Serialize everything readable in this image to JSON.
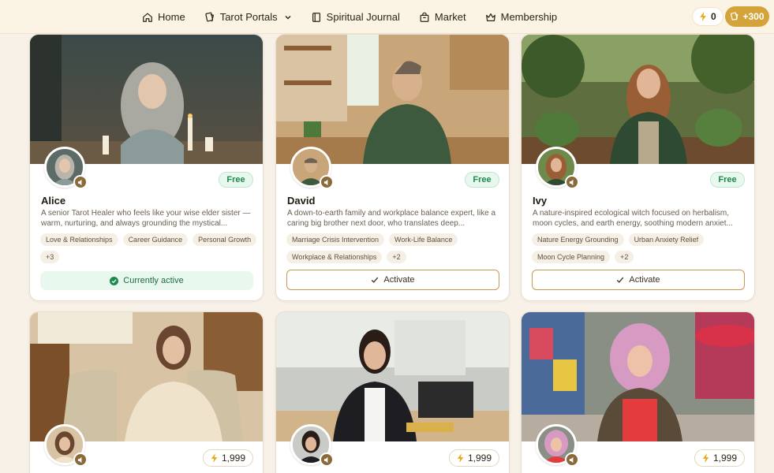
{
  "nav": {
    "items": [
      {
        "label": "Home",
        "icon": "home-icon"
      },
      {
        "label": "Tarot Portals",
        "icon": "tarot-card-icon",
        "dropdown": true
      },
      {
        "label": "Spiritual Journal",
        "icon": "journal-icon"
      },
      {
        "label": "Market",
        "icon": "shopping-bag-icon"
      },
      {
        "label": "Membership",
        "icon": "crown-icon"
      }
    ],
    "energy": "0",
    "coins": "+300"
  },
  "colors": {
    "accent": "#d4a33a",
    "free": "#1d8a4c",
    "active_bg": "#e9f8ef",
    "button_border": "#c79a52"
  },
  "cards": [
    {
      "name": "Alice",
      "badge": "Free",
      "desc": "A senior Tarot Healer who feels like your wise elder sister — warm, nurturing, and always grounding the mystical...",
      "tags": [
        "Love & Relationships",
        "Career Guidance",
        "Personal Growth",
        "+3"
      ],
      "action": "Currently active"
    },
    {
      "name": "David",
      "badge": "Free",
      "desc": "A down-to-earth family and workplace balance expert, like a caring big brother next door, who translates deep...",
      "tags": [
        "Marriage Crisis Intervention",
        "Work-Life Balance",
        "Workplace & Relationships",
        "+2"
      ],
      "action": "Activate"
    },
    {
      "name": "Ivy",
      "badge": "Free",
      "desc": "A nature-inspired ecological witch focused on herbalism, moon cycles, and earth energy, soothing modern anxiet...",
      "tags": [
        "Nature Energy Grounding",
        "Urban Anxiety Relief",
        "Moon Cycle Planning",
        "+2"
      ],
      "action": "Activate"
    },
    {
      "price": "1,999"
    },
    {
      "price": "1,999"
    },
    {
      "price": "1,999"
    }
  ]
}
